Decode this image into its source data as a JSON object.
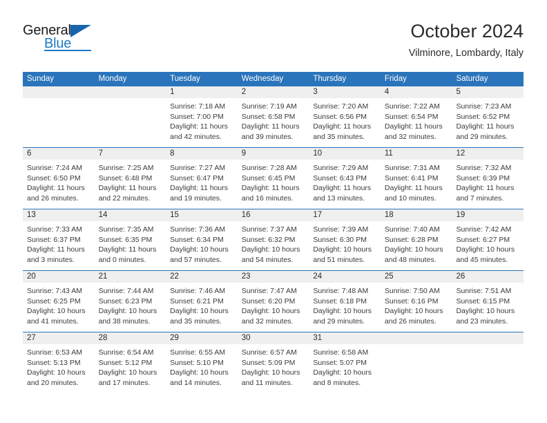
{
  "brand": {
    "name_part1": "General",
    "name_part2": "Blue",
    "accent_color": "#1f7ac4",
    "triangle_color": "#1665ad"
  },
  "header": {
    "title": "October 2024",
    "location": "Vilminore, Lombardy, Italy"
  },
  "theme": {
    "header_row_bg": "#2a74bb",
    "daynum_band_bg": "#efefef",
    "week_separator": "#2a74bb",
    "text_color": "#3a3a3a"
  },
  "weekdays": [
    "Sunday",
    "Monday",
    "Tuesday",
    "Wednesday",
    "Thursday",
    "Friday",
    "Saturday"
  ],
  "weeks": [
    [
      {
        "day": "",
        "sunrise": "",
        "sunset": "",
        "daylight_line1": "",
        "daylight_line2": "",
        "empty": true
      },
      {
        "day": "",
        "sunrise": "",
        "sunset": "",
        "daylight_line1": "",
        "daylight_line2": "",
        "empty": true
      },
      {
        "day": "1",
        "sunrise": "Sunrise: 7:18 AM",
        "sunset": "Sunset: 7:00 PM",
        "daylight_line1": "Daylight: 11 hours",
        "daylight_line2": "and 42 minutes."
      },
      {
        "day": "2",
        "sunrise": "Sunrise: 7:19 AM",
        "sunset": "Sunset: 6:58 PM",
        "daylight_line1": "Daylight: 11 hours",
        "daylight_line2": "and 39 minutes."
      },
      {
        "day": "3",
        "sunrise": "Sunrise: 7:20 AM",
        "sunset": "Sunset: 6:56 PM",
        "daylight_line1": "Daylight: 11 hours",
        "daylight_line2": "and 35 minutes."
      },
      {
        "day": "4",
        "sunrise": "Sunrise: 7:22 AM",
        "sunset": "Sunset: 6:54 PM",
        "daylight_line1": "Daylight: 11 hours",
        "daylight_line2": "and 32 minutes."
      },
      {
        "day": "5",
        "sunrise": "Sunrise: 7:23 AM",
        "sunset": "Sunset: 6:52 PM",
        "daylight_line1": "Daylight: 11 hours",
        "daylight_line2": "and 29 minutes."
      }
    ],
    [
      {
        "day": "6",
        "sunrise": "Sunrise: 7:24 AM",
        "sunset": "Sunset: 6:50 PM",
        "daylight_line1": "Daylight: 11 hours",
        "daylight_line2": "and 26 minutes."
      },
      {
        "day": "7",
        "sunrise": "Sunrise: 7:25 AM",
        "sunset": "Sunset: 6:48 PM",
        "daylight_line1": "Daylight: 11 hours",
        "daylight_line2": "and 22 minutes."
      },
      {
        "day": "8",
        "sunrise": "Sunrise: 7:27 AM",
        "sunset": "Sunset: 6:47 PM",
        "daylight_line1": "Daylight: 11 hours",
        "daylight_line2": "and 19 minutes."
      },
      {
        "day": "9",
        "sunrise": "Sunrise: 7:28 AM",
        "sunset": "Sunset: 6:45 PM",
        "daylight_line1": "Daylight: 11 hours",
        "daylight_line2": "and 16 minutes."
      },
      {
        "day": "10",
        "sunrise": "Sunrise: 7:29 AM",
        "sunset": "Sunset: 6:43 PM",
        "daylight_line1": "Daylight: 11 hours",
        "daylight_line2": "and 13 minutes."
      },
      {
        "day": "11",
        "sunrise": "Sunrise: 7:31 AM",
        "sunset": "Sunset: 6:41 PM",
        "daylight_line1": "Daylight: 11 hours",
        "daylight_line2": "and 10 minutes."
      },
      {
        "day": "12",
        "sunrise": "Sunrise: 7:32 AM",
        "sunset": "Sunset: 6:39 PM",
        "daylight_line1": "Daylight: 11 hours",
        "daylight_line2": "and 7 minutes."
      }
    ],
    [
      {
        "day": "13",
        "sunrise": "Sunrise: 7:33 AM",
        "sunset": "Sunset: 6:37 PM",
        "daylight_line1": "Daylight: 11 hours",
        "daylight_line2": "and 3 minutes."
      },
      {
        "day": "14",
        "sunrise": "Sunrise: 7:35 AM",
        "sunset": "Sunset: 6:35 PM",
        "daylight_line1": "Daylight: 11 hours",
        "daylight_line2": "and 0 minutes."
      },
      {
        "day": "15",
        "sunrise": "Sunrise: 7:36 AM",
        "sunset": "Sunset: 6:34 PM",
        "daylight_line1": "Daylight: 10 hours",
        "daylight_line2": "and 57 minutes."
      },
      {
        "day": "16",
        "sunrise": "Sunrise: 7:37 AM",
        "sunset": "Sunset: 6:32 PM",
        "daylight_line1": "Daylight: 10 hours",
        "daylight_line2": "and 54 minutes."
      },
      {
        "day": "17",
        "sunrise": "Sunrise: 7:39 AM",
        "sunset": "Sunset: 6:30 PM",
        "daylight_line1": "Daylight: 10 hours",
        "daylight_line2": "and 51 minutes."
      },
      {
        "day": "18",
        "sunrise": "Sunrise: 7:40 AM",
        "sunset": "Sunset: 6:28 PM",
        "daylight_line1": "Daylight: 10 hours",
        "daylight_line2": "and 48 minutes."
      },
      {
        "day": "19",
        "sunrise": "Sunrise: 7:42 AM",
        "sunset": "Sunset: 6:27 PM",
        "daylight_line1": "Daylight: 10 hours",
        "daylight_line2": "and 45 minutes."
      }
    ],
    [
      {
        "day": "20",
        "sunrise": "Sunrise: 7:43 AM",
        "sunset": "Sunset: 6:25 PM",
        "daylight_line1": "Daylight: 10 hours",
        "daylight_line2": "and 41 minutes."
      },
      {
        "day": "21",
        "sunrise": "Sunrise: 7:44 AM",
        "sunset": "Sunset: 6:23 PM",
        "daylight_line1": "Daylight: 10 hours",
        "daylight_line2": "and 38 minutes."
      },
      {
        "day": "22",
        "sunrise": "Sunrise: 7:46 AM",
        "sunset": "Sunset: 6:21 PM",
        "daylight_line1": "Daylight: 10 hours",
        "daylight_line2": "and 35 minutes."
      },
      {
        "day": "23",
        "sunrise": "Sunrise: 7:47 AM",
        "sunset": "Sunset: 6:20 PM",
        "daylight_line1": "Daylight: 10 hours",
        "daylight_line2": "and 32 minutes."
      },
      {
        "day": "24",
        "sunrise": "Sunrise: 7:48 AM",
        "sunset": "Sunset: 6:18 PM",
        "daylight_line1": "Daylight: 10 hours",
        "daylight_line2": "and 29 minutes."
      },
      {
        "day": "25",
        "sunrise": "Sunrise: 7:50 AM",
        "sunset": "Sunset: 6:16 PM",
        "daylight_line1": "Daylight: 10 hours",
        "daylight_line2": "and 26 minutes."
      },
      {
        "day": "26",
        "sunrise": "Sunrise: 7:51 AM",
        "sunset": "Sunset: 6:15 PM",
        "daylight_line1": "Daylight: 10 hours",
        "daylight_line2": "and 23 minutes."
      }
    ],
    [
      {
        "day": "27",
        "sunrise": "Sunrise: 6:53 AM",
        "sunset": "Sunset: 5:13 PM",
        "daylight_line1": "Daylight: 10 hours",
        "daylight_line2": "and 20 minutes."
      },
      {
        "day": "28",
        "sunrise": "Sunrise: 6:54 AM",
        "sunset": "Sunset: 5:12 PM",
        "daylight_line1": "Daylight: 10 hours",
        "daylight_line2": "and 17 minutes."
      },
      {
        "day": "29",
        "sunrise": "Sunrise: 6:55 AM",
        "sunset": "Sunset: 5:10 PM",
        "daylight_line1": "Daylight: 10 hours",
        "daylight_line2": "and 14 minutes."
      },
      {
        "day": "30",
        "sunrise": "Sunrise: 6:57 AM",
        "sunset": "Sunset: 5:09 PM",
        "daylight_line1": "Daylight: 10 hours",
        "daylight_line2": "and 11 minutes."
      },
      {
        "day": "31",
        "sunrise": "Sunrise: 6:58 AM",
        "sunset": "Sunset: 5:07 PM",
        "daylight_line1": "Daylight: 10 hours",
        "daylight_line2": "and 8 minutes."
      },
      {
        "day": "",
        "sunrise": "",
        "sunset": "",
        "daylight_line1": "",
        "daylight_line2": "",
        "empty": true
      },
      {
        "day": "",
        "sunrise": "",
        "sunset": "",
        "daylight_line1": "",
        "daylight_line2": "",
        "empty": true
      }
    ]
  ]
}
